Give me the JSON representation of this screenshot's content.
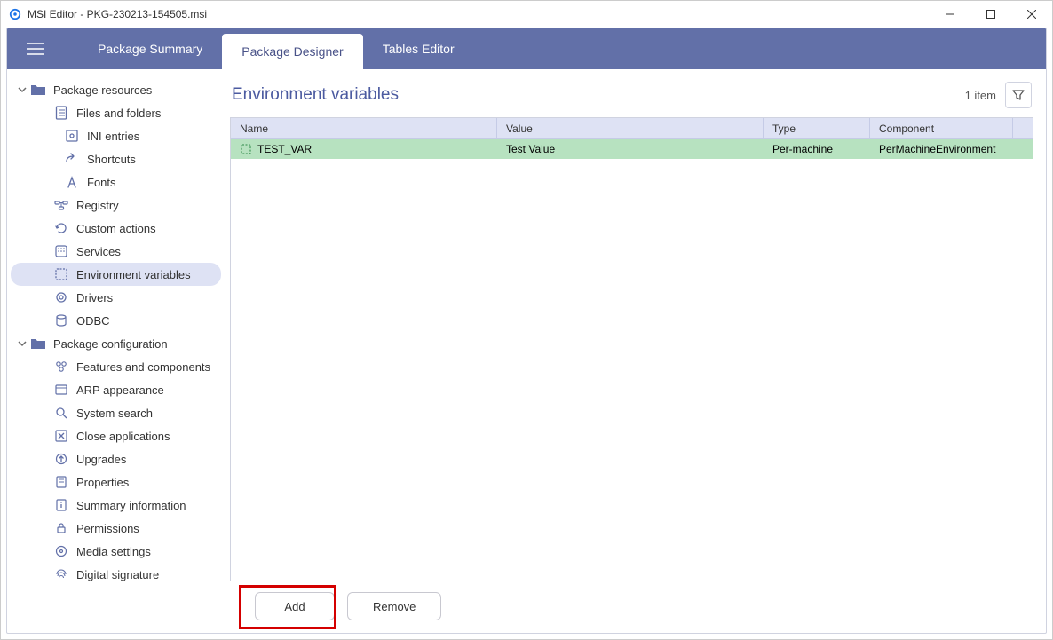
{
  "window": {
    "title": "MSI Editor - PKG-230213-154505.msi"
  },
  "tabs": {
    "summary": "Package Summary",
    "designer": "Package Designer",
    "tables": "Tables Editor"
  },
  "sidebar": {
    "group_resources": "Package resources",
    "files_folders": "Files and folders",
    "ini_entries": "INI entries",
    "shortcuts": "Shortcuts",
    "fonts": "Fonts",
    "registry": "Registry",
    "custom_actions": "Custom actions",
    "services": "Services",
    "env_vars": "Environment variables",
    "drivers": "Drivers",
    "odbc": "ODBC",
    "group_config": "Package configuration",
    "features": "Features and components",
    "arp": "ARP appearance",
    "system_search": "System search",
    "close_apps": "Close applications",
    "upgrades": "Upgrades",
    "properties": "Properties",
    "summary_info": "Summary information",
    "permissions": "Permissions",
    "media": "Media settings",
    "digital_sig": "Digital signature"
  },
  "content": {
    "title": "Environment variables",
    "item_count": "1 item"
  },
  "table": {
    "columns": {
      "name": "Name",
      "value": "Value",
      "type": "Type",
      "component": "Component"
    },
    "rows": [
      {
        "name": "TEST_VAR",
        "value": "Test Value",
        "type": "Per-machine",
        "component": "PerMachineEnvironment"
      }
    ]
  },
  "buttons": {
    "add": "Add",
    "remove": "Remove"
  }
}
